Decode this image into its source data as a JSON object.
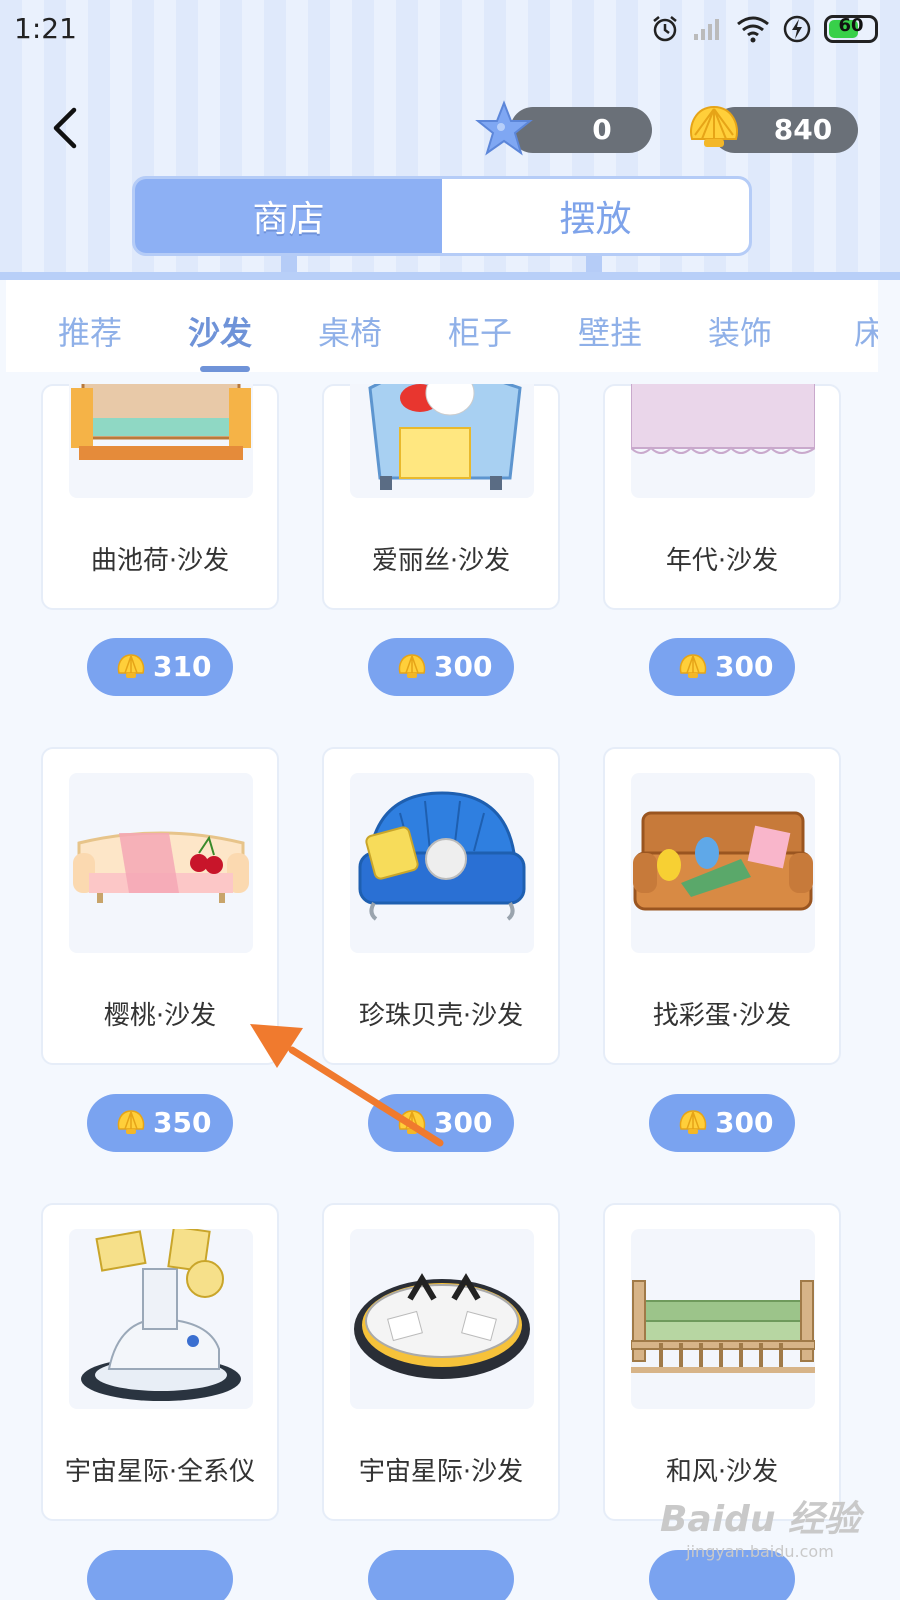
{
  "status": {
    "time": "1:21",
    "battery": "60"
  },
  "currency": {
    "stars": "0",
    "shells": "840"
  },
  "segments": [
    "商店",
    "摆放"
  ],
  "tabs": [
    "推荐",
    "沙发",
    "桌椅",
    "柜子",
    "壁挂",
    "装饰",
    "床"
  ],
  "items": [
    {
      "name": "曲池荷·沙发",
      "price": "310"
    },
    {
      "name": "爱丽丝·沙发",
      "price": "300"
    },
    {
      "name": "年代·沙发",
      "price": "300"
    },
    {
      "name": "樱桃·沙发",
      "price": "350"
    },
    {
      "name": "珍珠贝壳·沙发",
      "price": "300"
    },
    {
      "name": "找彩蛋·沙发",
      "price": "300"
    },
    {
      "name": "宇宙星际·全系仪",
      "price": ""
    },
    {
      "name": "宇宙星际·沙发",
      "price": ""
    },
    {
      "name": "和风·沙发",
      "price": ""
    }
  ],
  "watermark": {
    "logo": "Baidu 经验",
    "url": "jingyan.baidu.com"
  },
  "colors": {
    "accent": "#7aa3f0",
    "tab_active": "#6f93d8",
    "arrow": "#f07a2e"
  }
}
